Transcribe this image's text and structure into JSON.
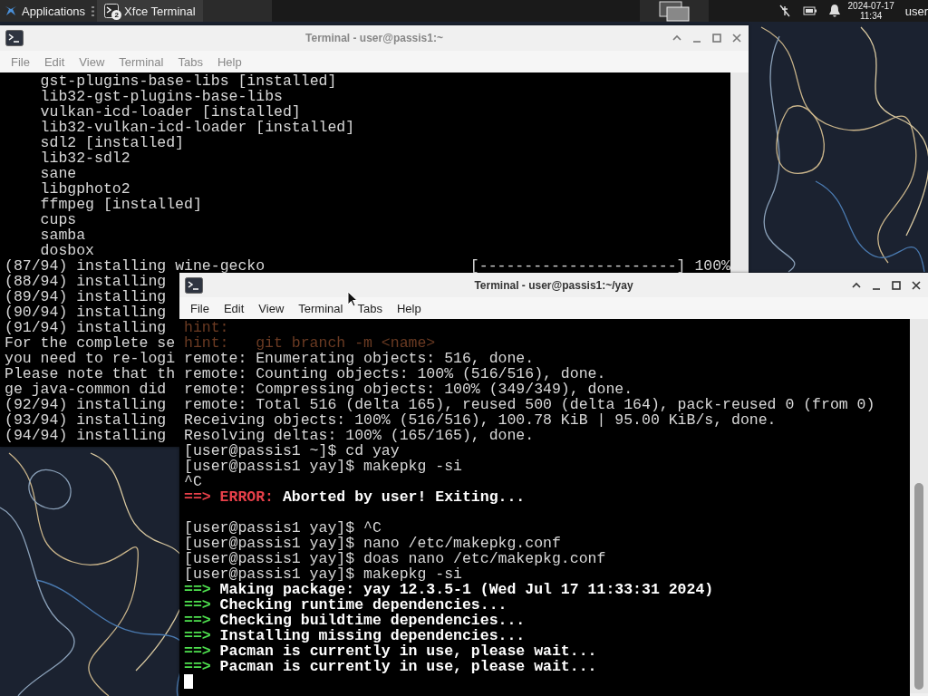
{
  "panel": {
    "applications": "Applications",
    "tasks": [
      {
        "label": "Xfce Terminal",
        "badge": "2",
        "selected": true
      }
    ],
    "date": "2024-07-17",
    "time": "11:34",
    "user": "user"
  },
  "windows": [
    {
      "title": "Terminal - user@passis1:~",
      "active": false,
      "menu": [
        "File",
        "Edit",
        "View",
        "Terminal",
        "Tabs",
        "Help"
      ],
      "lines": [
        {
          "kind": "item",
          "text": "gst-plugins-base-libs [installed]"
        },
        {
          "kind": "item",
          "text": "lib32-gst-plugins-base-libs"
        },
        {
          "kind": "item",
          "text": "vulkan-icd-loader [installed]"
        },
        {
          "kind": "item",
          "text": "lib32-vulkan-icd-loader [installed]"
        },
        {
          "kind": "item",
          "text": "sdl2 [installed]"
        },
        {
          "kind": "item",
          "text": "lib32-sdl2"
        },
        {
          "kind": "item",
          "text": "sane"
        },
        {
          "kind": "item",
          "text": "libgphoto2"
        },
        {
          "kind": "item",
          "text": "ffmpeg [installed]"
        },
        {
          "kind": "item",
          "text": "cups"
        },
        {
          "kind": "item",
          "text": "samba"
        },
        {
          "kind": "item",
          "text": "dosbox"
        },
        {
          "kind": "progress",
          "text": "(87/94) installing wine-gecko",
          "bar": "[----------------------]",
          "percent": "100%"
        },
        {
          "kind": "plain",
          "text": "(88/94) installing"
        },
        {
          "kind": "plain",
          "text": "(89/94) installing"
        },
        {
          "kind": "plain",
          "text": "(90/94) installing"
        },
        {
          "kind": "plain",
          "text": "(91/94) installing"
        },
        {
          "kind": "plain",
          "text": "For the complete se"
        },
        {
          "kind": "plain",
          "text": "you need to re-logi"
        },
        {
          "kind": "plain",
          "text": "Please note that th"
        },
        {
          "kind": "plain",
          "text": "ge java-common did"
        },
        {
          "kind": "plain",
          "text": "(92/94) installing"
        },
        {
          "kind": "plain",
          "text": "(93/94) installing"
        },
        {
          "kind": "plain",
          "text": "(94/94) installing"
        }
      ]
    },
    {
      "title": "Terminal - user@passis1:~/yay",
      "active": true,
      "menu": [
        "File",
        "Edit",
        "View",
        "Terminal",
        "Tabs",
        "Help"
      ],
      "cursor": true,
      "lines": [
        {
          "kind": "hint",
          "text": "hint:"
        },
        {
          "kind": "hint",
          "text": "hint:   git branch -m <name>"
        },
        {
          "kind": "plain",
          "text": "remote: Enumerating objects: 516, done."
        },
        {
          "kind": "plain",
          "text": "remote: Counting objects: 100% (516/516), done."
        },
        {
          "kind": "plain",
          "text": "remote: Compressing objects: 100% (349/349), done."
        },
        {
          "kind": "plain",
          "text": "remote: Total 516 (delta 165), reused 500 (delta 164), pack-reused 0 (from 0)"
        },
        {
          "kind": "plain",
          "text": "Receiving objects: 100% (516/516), 100.78 KiB | 95.00 KiB/s, done."
        },
        {
          "kind": "plain",
          "text": "Resolving deltas: 100% (165/165), done."
        },
        {
          "kind": "plain",
          "text": "[user@passis1 ~]$ cd yay"
        },
        {
          "kind": "plain",
          "text": "[user@passis1 yay]$ makepkg -si"
        },
        {
          "kind": "plain",
          "text": "^C"
        },
        {
          "kind": "error",
          "arrow": "==>",
          "label": "ERROR:",
          "text": "Aborted by user! Exiting..."
        },
        {
          "kind": "blank"
        },
        {
          "kind": "plain",
          "text": "[user@passis1 yay]$ ^C"
        },
        {
          "kind": "plain",
          "text": "[user@passis1 yay]$ nano /etc/makepkg.conf"
        },
        {
          "kind": "plain",
          "text": "[user@passis1 yay]$ doas nano /etc/makepkg.conf"
        },
        {
          "kind": "plain",
          "text": "[user@passis1 yay]$ makepkg -si"
        },
        {
          "kind": "info",
          "arrow": "==>",
          "text": "Making package: yay 12.3.5-1 (Wed Jul 17 11:33:31 2024)"
        },
        {
          "kind": "info",
          "arrow": "==>",
          "text": "Checking runtime dependencies..."
        },
        {
          "kind": "info",
          "arrow": "==>",
          "text": "Checking buildtime dependencies..."
        },
        {
          "kind": "info",
          "arrow": "==>",
          "text": "Installing missing dependencies..."
        },
        {
          "kind": "info",
          "arrow": "==>",
          "text": "Pacman is currently in use, please wait..."
        },
        {
          "kind": "info",
          "arrow": "==>",
          "text": "Pacman is currently in use, please wait..."
        }
      ]
    }
  ]
}
